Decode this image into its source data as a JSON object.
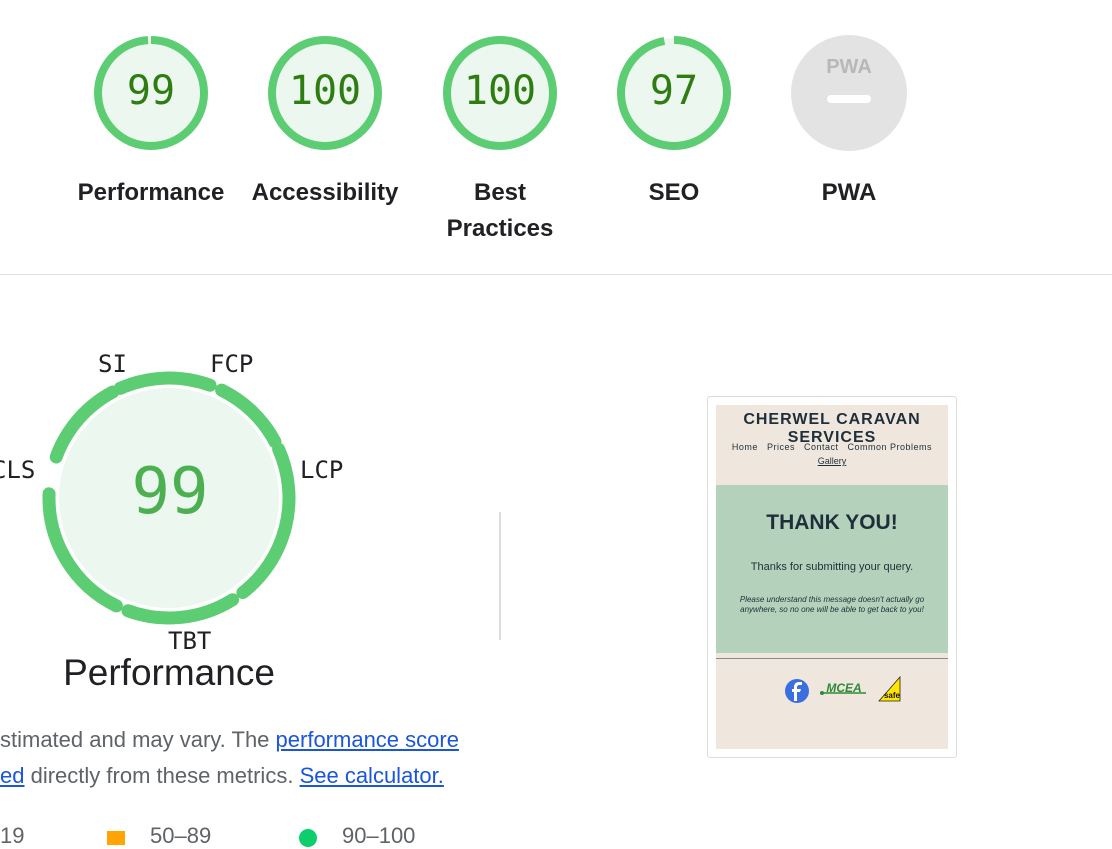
{
  "categories": [
    {
      "label": "Performance",
      "score": "99",
      "value": 0.99,
      "color": "#0cce6b"
    },
    {
      "label": "Accessibility",
      "score": "100",
      "value": 1.0,
      "color": "#0cce6b"
    },
    {
      "label": "Best Practices",
      "score": "100",
      "value": 1.0,
      "color": "#0cce6b"
    },
    {
      "label": "SEO",
      "score": "97",
      "value": 0.97,
      "color": "#0cce6b"
    },
    {
      "label": "PWA",
      "score": "PWA",
      "value": null,
      "color": "#c8c8c8"
    }
  ],
  "performance": {
    "score": "99",
    "title": "Performance",
    "metrics": {
      "si": "SI",
      "fcp": "FCP",
      "lcp": "LCP",
      "tbt": "TBT",
      "cls": "CLS"
    },
    "desc_line1_text": "stimated and may vary. The ",
    "desc_line1_link": "performance score",
    "desc_line2_link1": "ed",
    "desc_line2_text": " directly from these metrics. ",
    "desc_line2_link2": "See calculator."
  },
  "legend": {
    "poor": "19",
    "average": "50–89",
    "good": "90–100"
  },
  "screenshot": {
    "site_title": "CHERWEL CARAVAN SERVICES",
    "nav": [
      "Home",
      "Prices",
      "Contact",
      "Common Problems"
    ],
    "nav_gallery": "Gallery",
    "heading": "THANK YOU!",
    "message": "Thanks for submitting your query.",
    "note": "Please understand this message doesn't actually go anywhere, so no one will be able to get back to you!",
    "footer_logos": [
      "facebook-logo",
      "mcea-logo",
      "gas-safe-logo"
    ],
    "logo_text_mcea": "MCEA",
    "logo_text_safe": "safe"
  }
}
